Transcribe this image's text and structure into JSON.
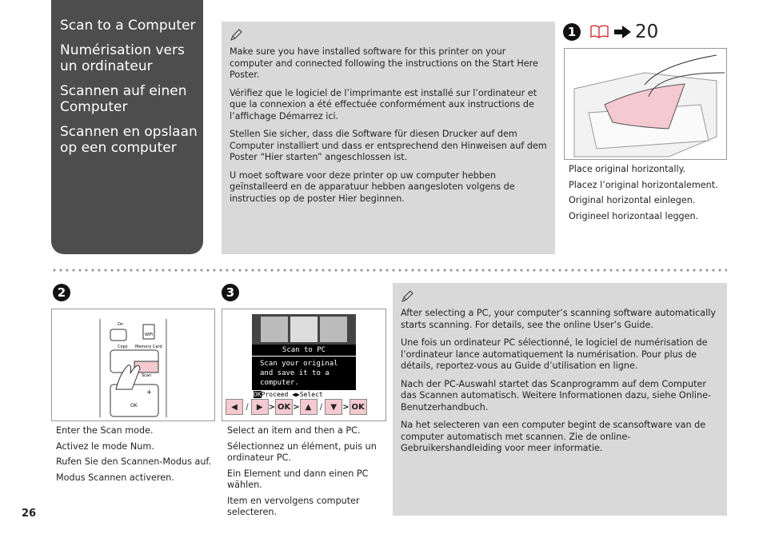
{
  "sidebar": {
    "titles": [
      "Scan to a Computer",
      "Numérisation vers un ordinateur",
      "Scannen auf einen Computer",
      "Scannen en opslaan op een computer"
    ]
  },
  "note1": {
    "icon": "pencil-note-icon",
    "paragraphs": [
      "Make sure you have installed software for this printer on your computer and connected following the instructions on the Start Here Poster.",
      "Vérifiez que le logiciel de l’imprimante est installé sur l’ordinateur et que la connexion a été effectuée conformément aux instructions de l’affichage Démarrez ici.",
      "Stellen Sie sicher, dass die Software für diesen Drucker auf dem Computer installiert und dass er entsprechend den Hinweisen auf dem Poster “Hier starten” angeschlossen ist.",
      "U moet software voor deze printer op uw computer hebben geïnstalleerd en de apparatuur hebben aangesloten volgens de instructies op de poster Hier beginnen."
    ]
  },
  "step1": {
    "number": "1",
    "ref_page": "20",
    "lines": [
      "Place original horizontally.",
      "Placez l’original horizontalement.",
      "Original horizontal einlegen.",
      "Origineel horizontaal leggen."
    ]
  },
  "step2": {
    "number": "2",
    "lines": [
      "Enter the Scan mode.",
      "Activez le mode Num.",
      "Rufen Sie den Scannen-Modus auf.",
      "Modus Scannen activeren."
    ],
    "panel": {
      "on": "On",
      "wifi": "WiFi",
      "copy": "Copy",
      "memory": "Memory Card",
      "scan": "Scan",
      "ok": "OK",
      "plus": "+"
    }
  },
  "step3": {
    "number": "3",
    "lines": [
      "Select an item and then a PC.",
      "Sélectionnez un élément, puis un ordinateur PC.",
      "Ein Element und dann einen PC wählen.",
      "Item en vervolgens computer selecteren."
    ],
    "lcd": {
      "title": "Scan to PC",
      "message": "Scan your original and save it to a computer.",
      "proceed": "Proceed",
      "select": "Select",
      "ok": "OK"
    },
    "keys": {
      "ok": "OK",
      "slash": "/"
    }
  },
  "note2": {
    "icon": "pencil-note-icon",
    "paragraphs": [
      "After selecting a PC, your computer’s scanning software automatically starts scanning. For details, see the online User’s Guide.",
      "Une fois un ordinateur PC sélectionné, le logiciel de numérisation de l’ordinateur lance automatiquement la numérisation. Pour plus de détails, reportez-vous au Guide d’utilisation en ligne.",
      "Nach der PC-Auswahl startet das Scanprogramm auf dem Computer das Scannen automatisch. Weitere Informationen dazu, siehe Online-Benutzerhandbuch.",
      "Na het selecteren van een computer begint de scansoftware van de computer automatisch met scannen. Zie de online-Gebruikershandleiding voor meer informatie."
    ]
  },
  "page_number": "26",
  "colors": {
    "sidebar": "#4d4d4d",
    "note": "#d9d9d9",
    "highlight": "#f4c9cf",
    "book_icon": "#d2232a"
  }
}
